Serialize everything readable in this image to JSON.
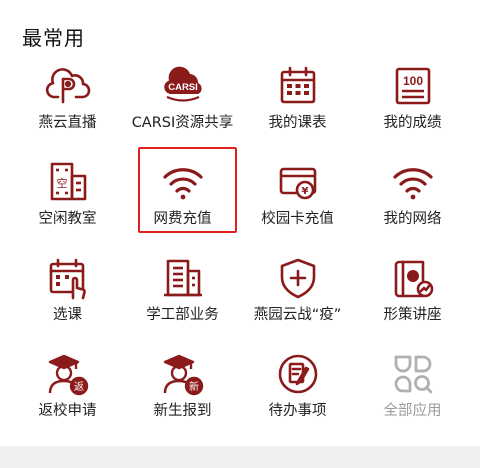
{
  "section": {
    "title": "最常用"
  },
  "colors": {
    "accent": "#8b1a1a",
    "muted": "#b0b0b0",
    "highlight": "#e11f1f"
  },
  "tiles": [
    {
      "label": "燕云直播",
      "icon": "yanyun-live-icon"
    },
    {
      "label": "CARSI资源共享",
      "icon": "carsi-cloud-icon",
      "icon_text": "CARSI"
    },
    {
      "label": "我的课表",
      "icon": "calendar-grid-icon"
    },
    {
      "label": "我的成绩",
      "icon": "score-100-icon",
      "icon_text": "100"
    },
    {
      "label": "空闲教室",
      "icon": "building-kong-icon",
      "icon_text": "空"
    },
    {
      "label": "网费充值",
      "icon": "wifi-icon",
      "highlighted": true
    },
    {
      "label": "校园卡充值",
      "icon": "card-yen-icon",
      "icon_text": "¥"
    },
    {
      "label": "我的网络",
      "icon": "wifi-icon"
    },
    {
      "label": "选课",
      "icon": "calendar-hand-icon"
    },
    {
      "label": "学工部业务",
      "icon": "office-building-icon"
    },
    {
      "label": "燕园云战“疫”",
      "icon": "shield-plus-icon"
    },
    {
      "label": "形策讲座",
      "icon": "policy-book-icon"
    },
    {
      "label": "返校申请",
      "icon": "graduate-return-icon",
      "icon_text": "返"
    },
    {
      "label": "新生报到",
      "icon": "graduate-new-icon",
      "icon_text": "新"
    },
    {
      "label": "待办事项",
      "icon": "todo-edit-icon"
    },
    {
      "label": "全部应用",
      "icon": "all-apps-icon",
      "muted": true
    }
  ]
}
